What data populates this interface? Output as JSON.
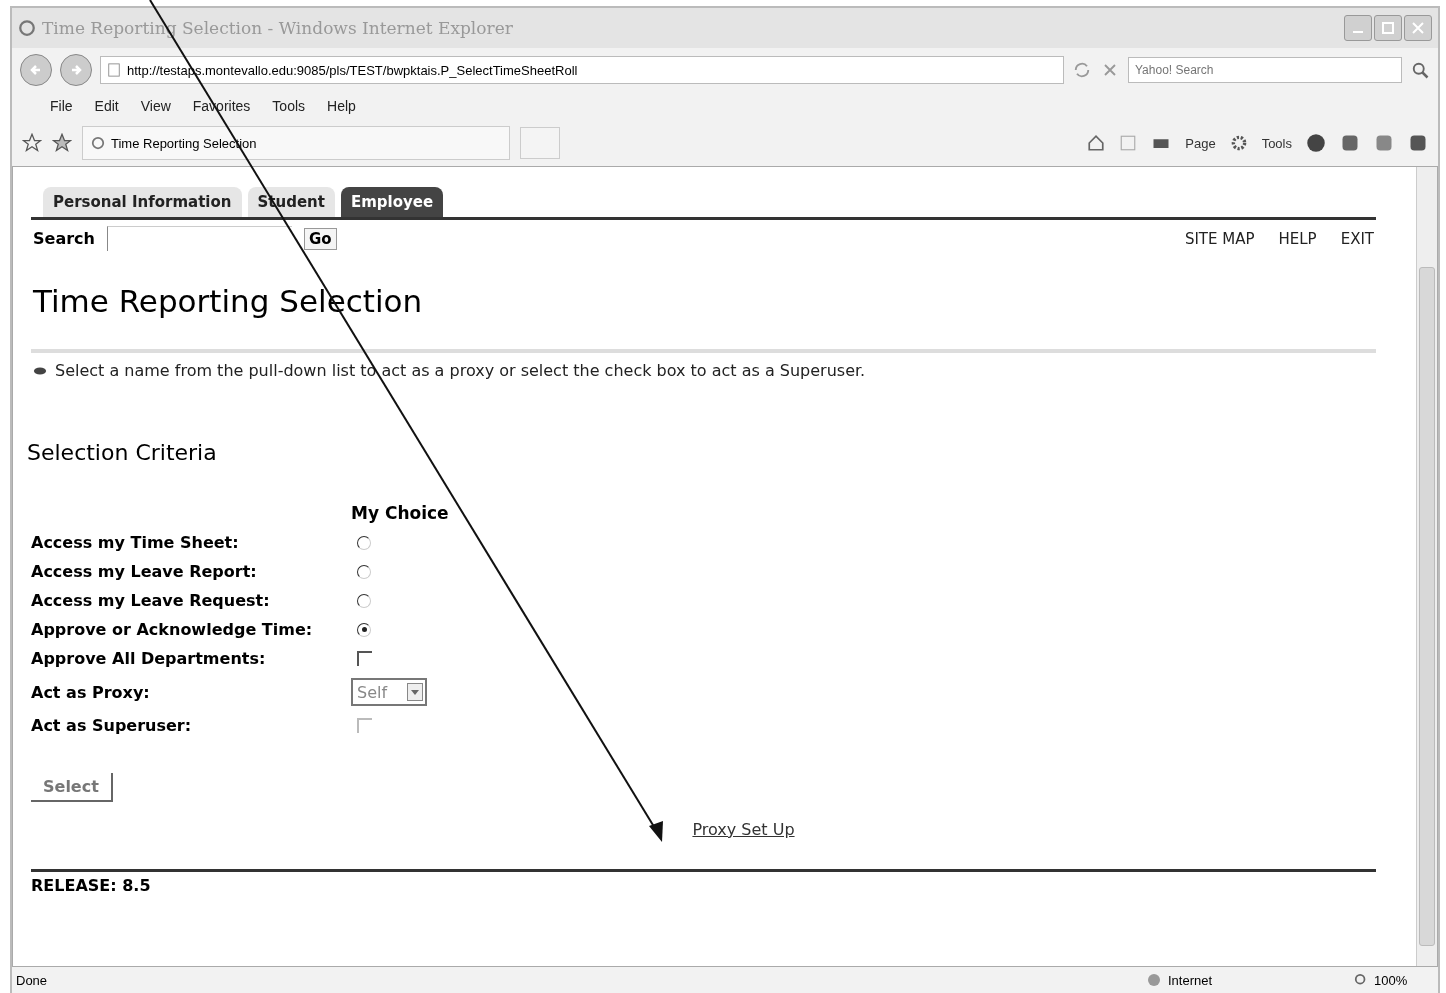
{
  "window": {
    "title": "Time Reporting Selection - Windows Internet Explorer"
  },
  "address_bar": {
    "url": "http://testaps.montevallo.edu:9085/pls/TEST/bwpktais.P_SelectTimeSheetRoll"
  },
  "web_search": {
    "placeholder": "Yahoo! Search"
  },
  "menu": [
    "File",
    "Edit",
    "View",
    "Favorites",
    "Tools",
    "Help"
  ],
  "browser_tab": {
    "title": "Time Reporting Selection"
  },
  "command_bar": [
    "Page",
    "Tools"
  ],
  "page": {
    "tabs": [
      {
        "label": "Personal Information",
        "selected": false
      },
      {
        "label": "Student",
        "selected": false
      },
      {
        "label": "Employee",
        "selected": true
      }
    ],
    "search": {
      "label": "Search",
      "button": "Go"
    },
    "top_links": [
      "SITE MAP",
      "HELP",
      "EXIT"
    ],
    "heading": "Time Reporting Selection",
    "info": "Select a name from the pull-down list to act as a proxy or select the check box to act as a Superuser.",
    "section": "Selection Criteria",
    "column_header": "My Choice",
    "rows": [
      {
        "label": "Access my Time Sheet:",
        "kind": "radio",
        "selected": false
      },
      {
        "label": "Access my Leave Report:",
        "kind": "radio",
        "selected": false
      },
      {
        "label": "Access my Leave Request:",
        "kind": "radio",
        "selected": false
      },
      {
        "label": "Approve or Acknowledge Time:",
        "kind": "radio",
        "selected": true
      },
      {
        "label": "Approve All Departments:",
        "kind": "checkbox",
        "checked": false,
        "disabled": false
      },
      {
        "label": "Act as Proxy:",
        "kind": "select",
        "value": "Self"
      },
      {
        "label": "Act as Superuser:",
        "kind": "checkbox",
        "checked": false,
        "disabled": true
      }
    ],
    "submit": "Select",
    "link": "Proxy Set Up",
    "release": "RELEASE: 8.5"
  },
  "status_bar": {
    "status": "Done",
    "zone": "Internet",
    "zoom": "100%"
  }
}
